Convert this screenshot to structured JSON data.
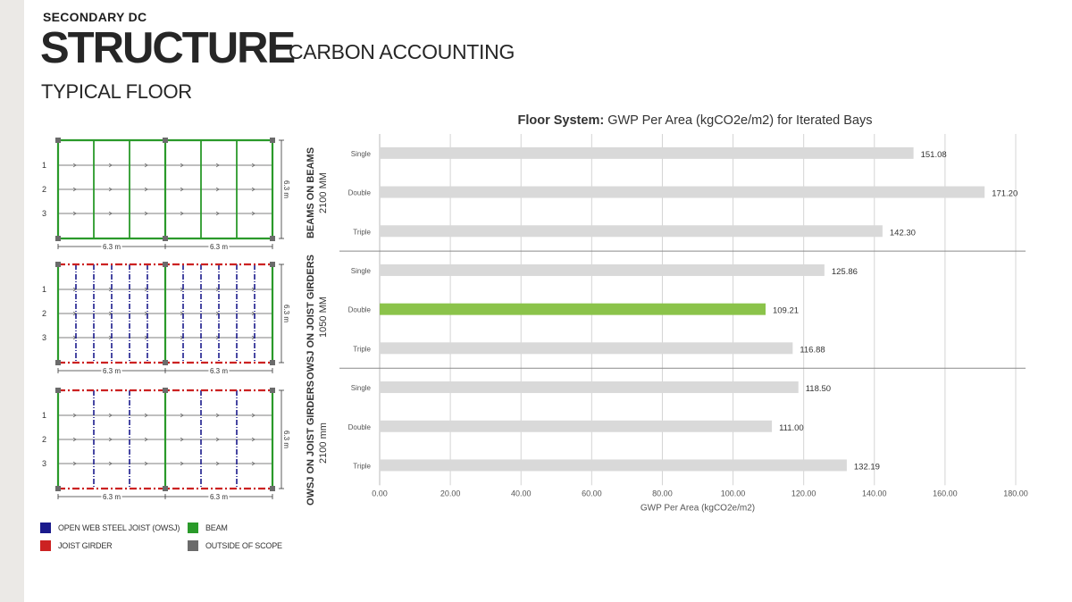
{
  "header": {
    "supertitle": "SECONDARY DC",
    "title": "STRUCTURE",
    "subtitle": "CARBON ACCOUNTING",
    "section": "TYPICAL FLOOR"
  },
  "plans": {
    "dim_label": "6.3 m",
    "row_labels": [
      "1",
      "2",
      "3"
    ],
    "systems": [
      {
        "line1": "BEAMS ON BEAMS",
        "line2": "2100 MM"
      },
      {
        "line1": "OWSJ ON JOIST GIRDERS",
        "line2": "1050 MM"
      },
      {
        "line1": "OWSJ ON JOIST GIRDERS",
        "line2": "2100 mm"
      }
    ]
  },
  "legend": [
    {
      "label": "OPEN WEB STEEL JOIST (OWSJ)",
      "color": "#1a1a8c"
    },
    {
      "label": "BEAM",
      "color": "#2a9a2a"
    },
    {
      "label": "JOIST GIRDER",
      "color": "#cc2222"
    },
    {
      "label": "OUTSIDE OF SCOPE",
      "color": "#6b6b6b"
    }
  ],
  "colors": {
    "bar": "#d9d9d9",
    "highlight": "#8bc34a",
    "beam": "#2a9a2a",
    "joist": "#1a1a8c",
    "girder": "#cc2222",
    "column": "#6b6b6b"
  },
  "chart_data": {
    "type": "bar",
    "orientation": "horizontal",
    "title_bold": "Floor System:",
    "title_rest": " GWP Per Area (kgCO2e/m2) for Iterated Bays",
    "xlabel": "GWP Per Area (kgCO2e/m2)",
    "xlim": [
      0,
      180
    ],
    "xticks": [
      "0.00",
      "20.00",
      "40.00",
      "60.00",
      "80.00",
      "100.00",
      "120.00",
      "140.00",
      "160.00",
      "180.00"
    ],
    "grid": true,
    "groups": [
      {
        "categories": [
          "Single",
          "Double",
          "Triple"
        ],
        "values": [
          151.08,
          171.2,
          142.3
        ],
        "labels": [
          "151.08",
          "171.20",
          "142.30"
        ]
      },
      {
        "categories": [
          "Single",
          "Double",
          "Triple"
        ],
        "values": [
          125.86,
          109.21,
          116.88
        ],
        "labels": [
          "125.86",
          "109.21",
          "116.88"
        ],
        "highlight_index": 1
      },
      {
        "categories": [
          "Single",
          "Double",
          "Triple"
        ],
        "values": [
          118.5,
          111.0,
          132.19
        ],
        "labels": [
          "118.50",
          "111.00",
          "132.19"
        ]
      }
    ]
  }
}
